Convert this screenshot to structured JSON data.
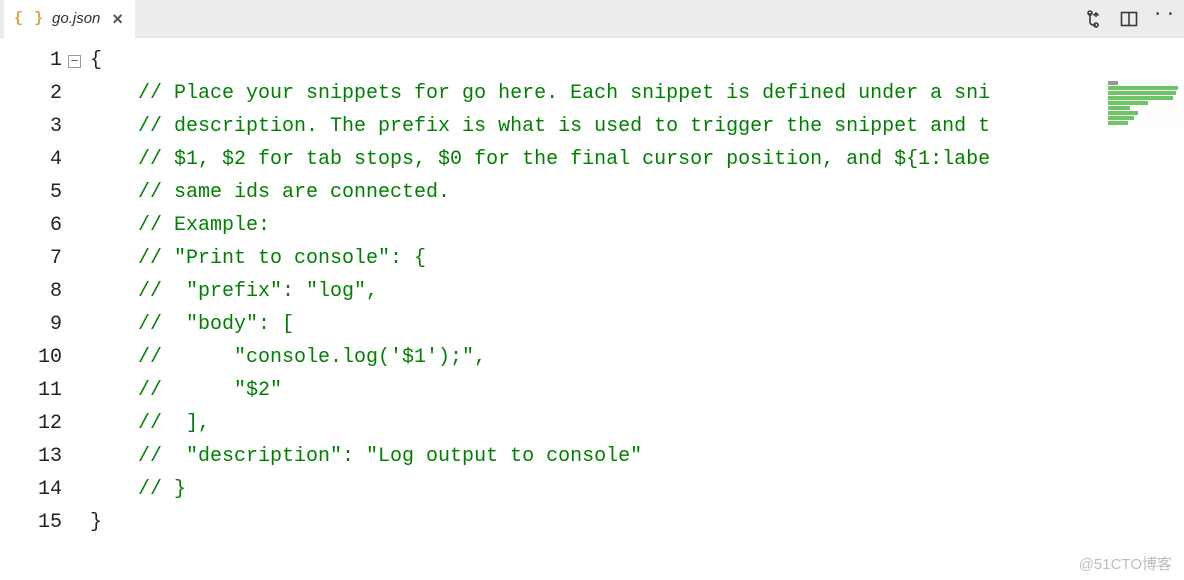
{
  "tab": {
    "icon_text": "{ }",
    "filename": "go.json",
    "close_glyph": "×"
  },
  "toolbar": {
    "compare_icon": "compare-changes-icon",
    "split_icon": "split-editor-icon",
    "more_icon": "more-actions-icon"
  },
  "editor": {
    "fold_glyph": "−",
    "lines": [
      {
        "n": 1,
        "kind": "brace",
        "indent": 0,
        "text": "{",
        "foldable": true
      },
      {
        "n": 2,
        "kind": "comment",
        "indent": 1,
        "text": "// Place your snippets for go here. Each snippet is defined under a sni"
      },
      {
        "n": 3,
        "kind": "comment",
        "indent": 1,
        "text": "// description. The prefix is what is used to trigger the snippet and t"
      },
      {
        "n": 4,
        "kind": "comment",
        "indent": 1,
        "text": "// $1, $2 for tab stops, $0 for the final cursor position, and ${1:labe"
      },
      {
        "n": 5,
        "kind": "comment",
        "indent": 1,
        "text": "// same ids are connected."
      },
      {
        "n": 6,
        "kind": "comment",
        "indent": 1,
        "text": "// Example:"
      },
      {
        "n": 7,
        "kind": "comment",
        "indent": 1,
        "text": "// \"Print to console\": {"
      },
      {
        "n": 8,
        "kind": "comment",
        "indent": 1,
        "text": "//  \"prefix\": \"log\","
      },
      {
        "n": 9,
        "kind": "comment",
        "indent": 1,
        "text": "//  \"body\": ["
      },
      {
        "n": 10,
        "kind": "comment",
        "indent": 1,
        "text": "//      \"console.log('$1');\","
      },
      {
        "n": 11,
        "kind": "comment",
        "indent": 1,
        "text": "//      \"$2\""
      },
      {
        "n": 12,
        "kind": "comment",
        "indent": 1,
        "text": "//  ],"
      },
      {
        "n": 13,
        "kind": "comment",
        "indent": 1,
        "text": "//  \"description\": \"Log output to console\""
      },
      {
        "n": 14,
        "kind": "comment",
        "indent": 1,
        "text": "// }"
      },
      {
        "n": 15,
        "kind": "brace",
        "indent": 0,
        "text": "}"
      }
    ]
  },
  "watermark": "@51CTO博客"
}
